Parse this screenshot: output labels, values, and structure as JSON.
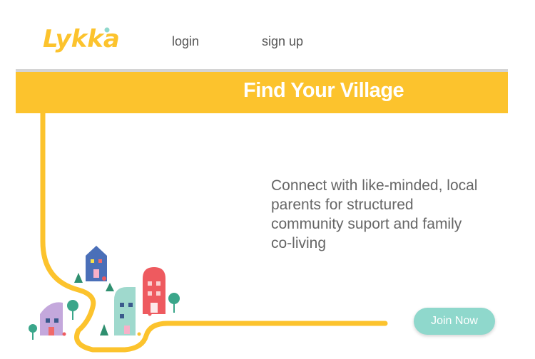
{
  "header": {
    "logo_text": "Lykka",
    "nav": {
      "login": "login",
      "signup": "sign up"
    }
  },
  "banner": {
    "title": "Find Your Village"
  },
  "hero": {
    "tagline": "Connect with like-minded, local parents for structured community suport and family co-living",
    "join_button": "Join Now"
  },
  "colors": {
    "brand_yellow": "#fcc32d",
    "button_teal": "#8fd8cc",
    "text_gray": "#666666"
  },
  "icons": [
    "village-illustration"
  ]
}
